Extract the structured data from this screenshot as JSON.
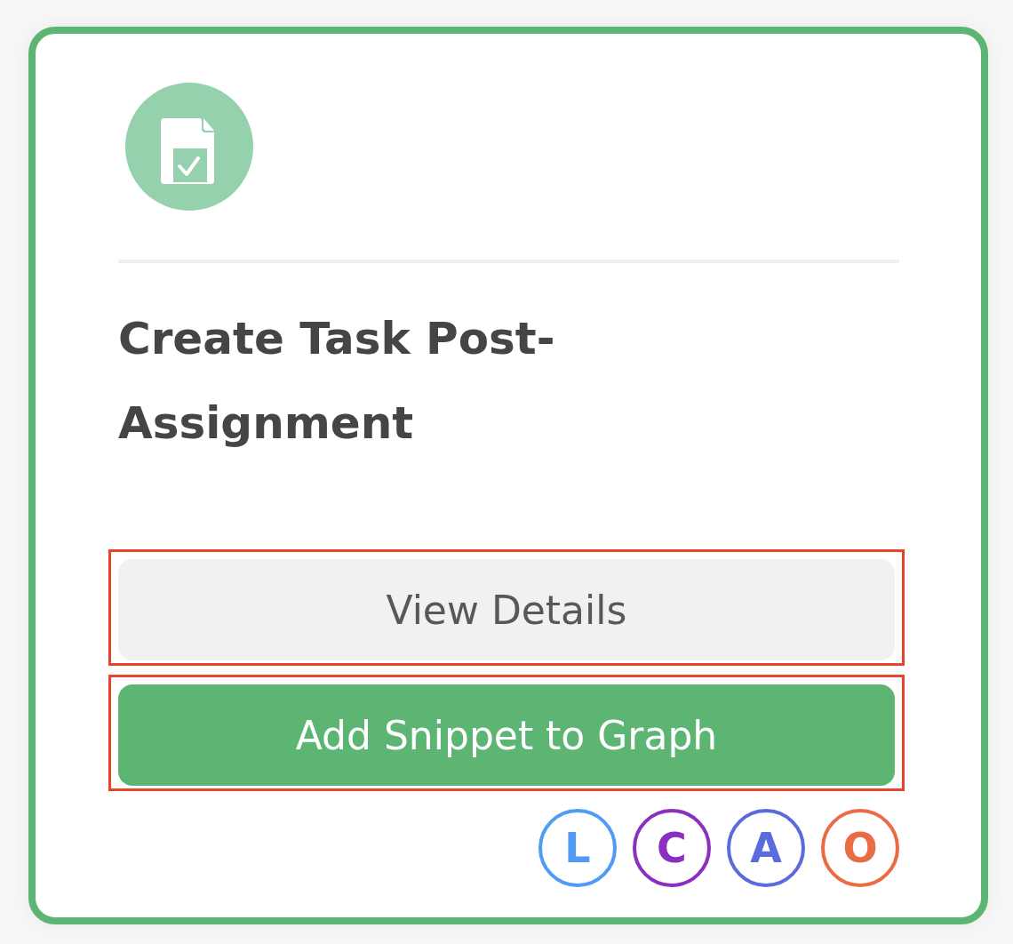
{
  "card": {
    "title": "Create Task Post-Assignment",
    "buttons": [
      {
        "label": "View Details",
        "kind": "secondary",
        "highlighted": true
      },
      {
        "label": "Add Snippet to Graph",
        "kind": "primary",
        "highlighted": true
      }
    ],
    "badges": [
      {
        "label": "L",
        "color": "#4f9bf5"
      },
      {
        "label": "C",
        "color": "#8a2fc0"
      },
      {
        "label": "A",
        "color": "#5b6bdc"
      },
      {
        "label": "O",
        "color": "#e96c45"
      }
    ]
  }
}
